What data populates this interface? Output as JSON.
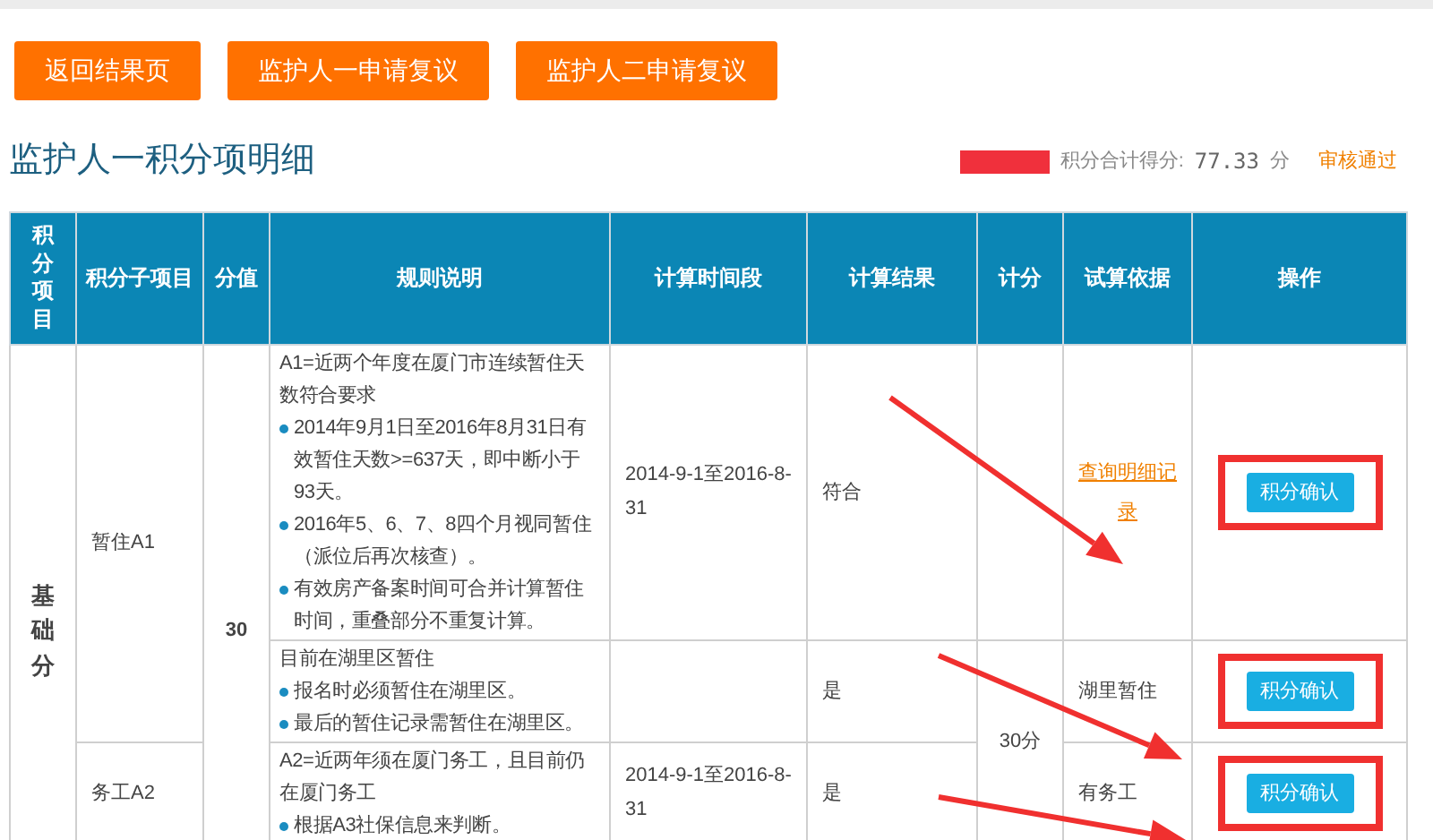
{
  "buttons": [
    {
      "label": "返回结果页"
    },
    {
      "label": "监护人一申请复议"
    },
    {
      "label": "监护人二申请复议"
    }
  ],
  "heading": {
    "title": "监护人一积分项明细",
    "total_label": "积分合计得分:",
    "total_value": "77.33",
    "total_unit": "分",
    "status": "审核通过"
  },
  "table": {
    "columns": [
      "积分项目",
      "积分子项目",
      "分值",
      "规则说明",
      "计算时间段",
      "计算结果",
      "计分",
      "试算依据",
      "操作"
    ],
    "categories": [
      {
        "label": "基础分",
        "value": "30",
        "subitems": [
          {
            "name": "暂住A1",
            "rows": [
              {
                "rule_title": "A1=近两个年度在厦门市连续暂住天数符合要求",
                "bullets": [
                  "2014年9月1日至2016年8月31日有效暂住天数>=637天，即中断小于93天。",
                  "2016年5、6、7、8四个月视同暂住（派位后再次核查）。",
                  "有效房产备案时间可合并计算暂住时间，重叠部分不重复计算。"
                ],
                "period": "2014-9-1至2016-8-31",
                "result": "符合",
                "merge_points_with_above": false,
                "basis": {
                  "kind": "link",
                  "text": "查询明细记录"
                },
                "action": "积分确认",
                "highlighted": true
              },
              {
                "rule_title": "目前在湖里区暂住",
                "bullets": [
                  "报名时必须暂住在湖里区。",
                  "最后的暂住记录需暂住在湖里区。"
                ],
                "result": "是",
                "points": "30分",
                "merge_points_with_above": false,
                "basis": {
                  "kind": "text",
                  "text": "湖里暂住"
                },
                "action": "积分确认",
                "highlighted": true
              }
            ]
          },
          {
            "name": "务工A2",
            "rows": [
              {
                "rule_title": "A2=近两年须在厦门务工，且目前仍在厦门务工",
                "bullets": [
                  "根据A3社保信息来判断。"
                ],
                "period": "2014-9-1至2016-8-31",
                "result": "是",
                "merge_points_with_above": true,
                "basis": {
                  "kind": "text",
                  "text": "有务工"
                },
                "action": "积分确认",
                "highlighted": true
              }
            ]
          }
        ]
      }
    ]
  }
}
